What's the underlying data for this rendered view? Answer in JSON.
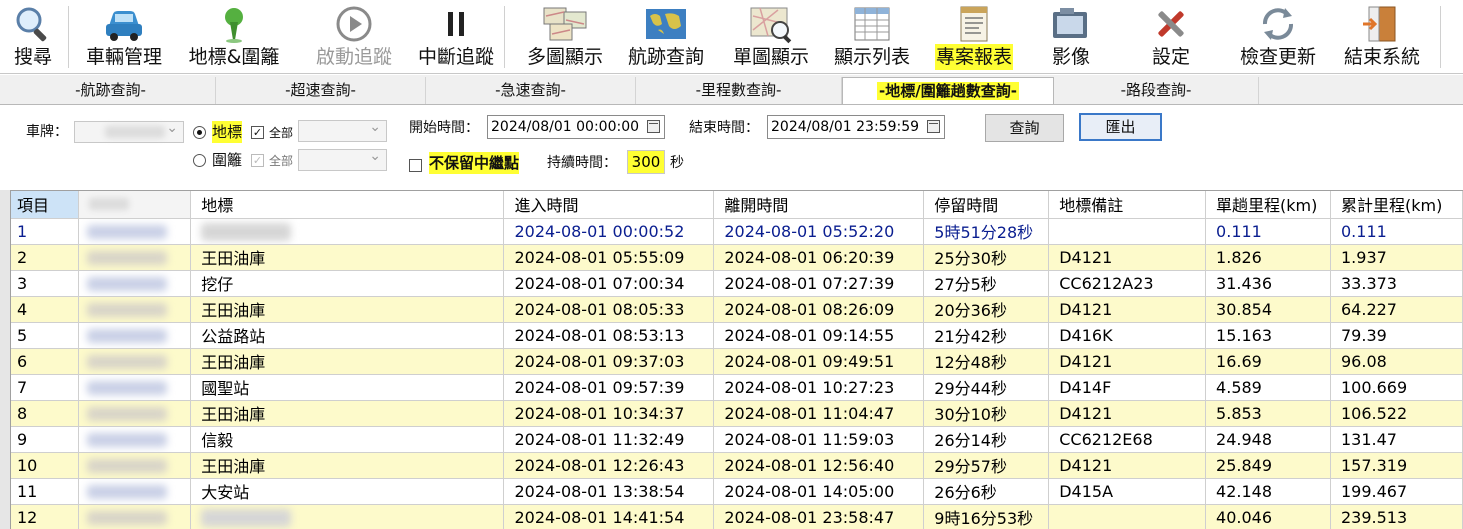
{
  "toolbar": {
    "buttons": [
      {
        "label": "搜尋",
        "icon": "magnifier-icon",
        "disabled": false
      },
      {
        "label": "車輛管理",
        "icon": "car-icon",
        "disabled": false
      },
      {
        "label": "地標&圍籬",
        "icon": "map-pin-icon",
        "disabled": false
      },
      {
        "label": "啟動追蹤",
        "icon": "play-icon",
        "disabled": true
      },
      {
        "label": "中斷追蹤",
        "icon": "pause-icon",
        "disabled": false
      },
      {
        "label": "多圖顯示",
        "icon": "multi-map-icon",
        "disabled": false
      },
      {
        "label": "航跡查詢",
        "icon": "world-map-icon",
        "disabled": false
      },
      {
        "label": "單圖顯示",
        "icon": "map-zoom-icon",
        "disabled": false
      },
      {
        "label": "顯示列表",
        "icon": "table-list-icon",
        "disabled": false
      },
      {
        "label": "專案報表",
        "icon": "report-icon",
        "disabled": false,
        "highlight": true
      },
      {
        "label": "影像",
        "icon": "image-icon",
        "disabled": false
      },
      {
        "label": "設定",
        "icon": "tools-icon",
        "disabled": false
      },
      {
        "label": "檢查更新",
        "icon": "refresh-icon",
        "disabled": false
      },
      {
        "label": "結束系統",
        "icon": "exit-door-icon",
        "disabled": false
      }
    ]
  },
  "tabs": [
    {
      "label": "-航跡查詢-",
      "active": false
    },
    {
      "label": "-超速查詢-",
      "active": false
    },
    {
      "label": "-急速查詢-",
      "active": false
    },
    {
      "label": "-里程數查詢-",
      "active": false
    },
    {
      "label": "-地標/圍籬趟數查詢-",
      "active": true
    },
    {
      "label": "-路段查詢-",
      "active": false
    }
  ],
  "filter": {
    "plate_label": "車牌：",
    "landmark_radio_label": "地標",
    "fence_radio_label": "圍籬",
    "all_label_1": "全部",
    "all_label_2": "全部",
    "no_relay_label": "不保留中繼點",
    "start_label": "開始時間：",
    "start_value": "2024/08/01 00:00:00",
    "end_label": "結束時間：",
    "end_value": "2024/08/01 23:59:59",
    "duration_label": "持續時間：",
    "duration_value": "300",
    "duration_unit": "秒",
    "query_button": "查詢",
    "export_button": "匯出"
  },
  "grid": {
    "columns": [
      "項目",
      "",
      "地標",
      "進入時間",
      "離開時間",
      "停留時間",
      "地標備註",
      "單趟里程(km)",
      "累計里程(km)"
    ],
    "rows": [
      {
        "no": "1",
        "landmark": "",
        "enter": "2024-08-01 00:00:52",
        "leave": "2024-08-01 05:52:20",
        "stay": "5時51分28秒",
        "note": "",
        "trip": "0.111",
        "total": "0.111"
      },
      {
        "no": "2",
        "landmark": "王田油庫",
        "enter": "2024-08-01 05:55:09",
        "leave": "2024-08-01 06:20:39",
        "stay": "25分30秒",
        "note": "D4121",
        "trip": "1.826",
        "total": "1.937"
      },
      {
        "no": "3",
        "landmark": "挖仔",
        "enter": "2024-08-01 07:00:34",
        "leave": "2024-08-01 07:27:39",
        "stay": "27分5秒",
        "note": "CC6212A23",
        "trip": "31.436",
        "total": "33.373"
      },
      {
        "no": "4",
        "landmark": "王田油庫",
        "enter": "2024-08-01 08:05:33",
        "leave": "2024-08-01 08:26:09",
        "stay": "20分36秒",
        "note": "D4121",
        "trip": "30.854",
        "total": "64.227"
      },
      {
        "no": "5",
        "landmark": "公益路站",
        "enter": "2024-08-01 08:53:13",
        "leave": "2024-08-01 09:14:55",
        "stay": "21分42秒",
        "note": "D416K",
        "trip": "15.163",
        "total": "79.39"
      },
      {
        "no": "6",
        "landmark": "王田油庫",
        "enter": "2024-08-01 09:37:03",
        "leave": "2024-08-01 09:49:51",
        "stay": "12分48秒",
        "note": "D4121",
        "trip": "16.69",
        "total": "96.08"
      },
      {
        "no": "7",
        "landmark": "國聖站",
        "enter": "2024-08-01 09:57:39",
        "leave": "2024-08-01 10:27:23",
        "stay": "29分44秒",
        "note": "D414F",
        "trip": "4.589",
        "total": "100.669"
      },
      {
        "no": "8",
        "landmark": "王田油庫",
        "enter": "2024-08-01 10:34:37",
        "leave": "2024-08-01 11:04:47",
        "stay": "30分10秒",
        "note": "D4121",
        "trip": "5.853",
        "total": "106.522"
      },
      {
        "no": "9",
        "landmark": "信毅",
        "enter": "2024-08-01 11:32:49",
        "leave": "2024-08-01 11:59:03",
        "stay": "26分14秒",
        "note": "CC6212E68",
        "trip": "24.948",
        "total": "131.47"
      },
      {
        "no": "10",
        "landmark": "王田油庫",
        "enter": "2024-08-01 12:26:43",
        "leave": "2024-08-01 12:56:40",
        "stay": "29分57秒",
        "note": "D4121",
        "trip": "25.849",
        "total": "157.319"
      },
      {
        "no": "11",
        "landmark": "大安站",
        "enter": "2024-08-01 13:38:54",
        "leave": "2024-08-01 14:05:00",
        "stay": "26分6秒",
        "note": "D415A",
        "trip": "42.148",
        "total": "199.467"
      },
      {
        "no": "12",
        "landmark": "",
        "enter": "2024-08-01 14:41:54",
        "leave": "2024-08-01 23:58:47",
        "stay": "9時16分53秒",
        "note": "",
        "trip": "40.046",
        "total": "239.513"
      }
    ]
  },
  "colors": {
    "highlight": "#ffff33",
    "row_alt": "#fdfacb",
    "header_selected": "#cde3f7",
    "selected_text": "#0a1e90"
  }
}
